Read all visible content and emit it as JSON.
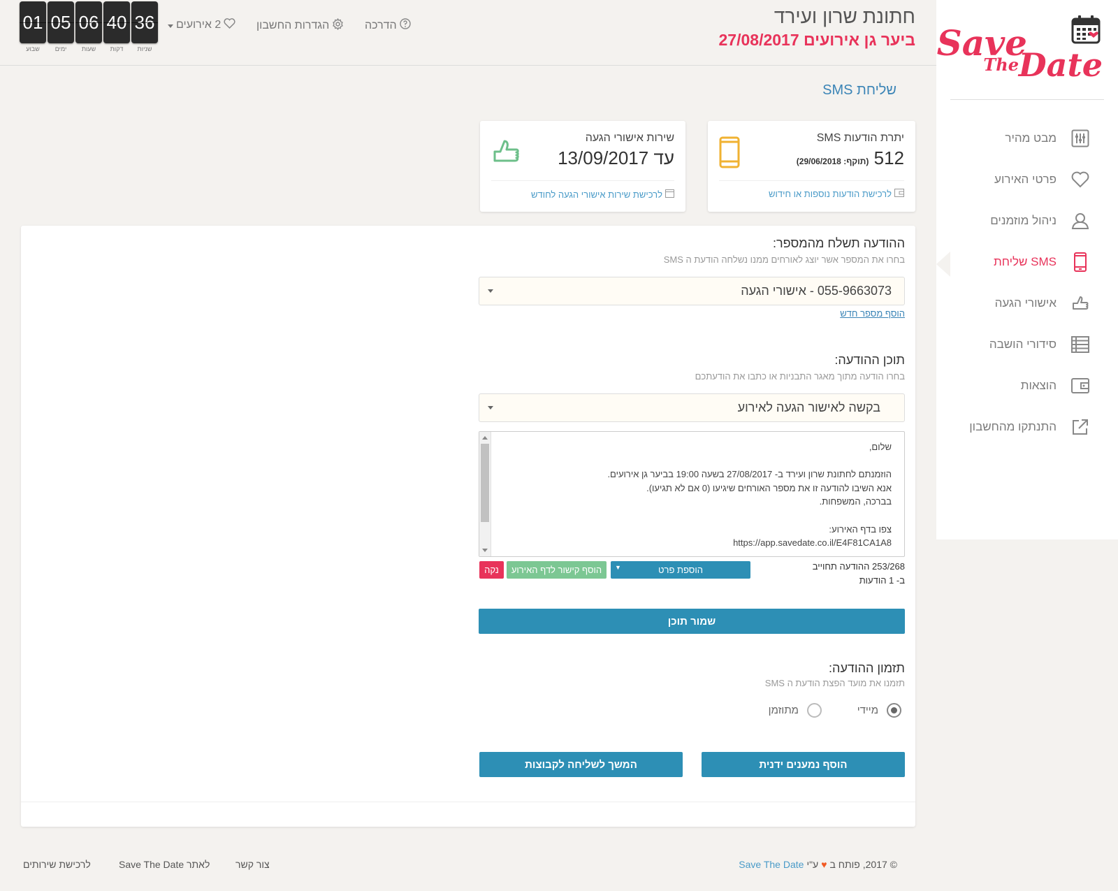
{
  "header": {
    "event_title": "חתונת שרון ועירד",
    "event_subtitle": "ביער גן אירועים 27/08/2017",
    "guide_label": "הדרכה",
    "account_settings_label": "הגדרות החשבון",
    "events_label": "2 אירועים"
  },
  "countdown": [
    {
      "value": "36",
      "label": "שניות"
    },
    {
      "value": "40",
      "label": "דקות"
    },
    {
      "value": "06",
      "label": "שעות"
    },
    {
      "value": "05",
      "label": "ימים"
    },
    {
      "value": "01",
      "label": "שבוע"
    }
  ],
  "logo": {
    "line1": "Save",
    "line2": "The",
    "line3": "Date"
  },
  "sidebar": {
    "items": [
      {
        "label": "מבט מהיר",
        "icon": "sliders-icon",
        "active": false
      },
      {
        "label": "פרטי האירוע",
        "icon": "heart-icon",
        "active": false
      },
      {
        "label": "ניהול מוזמנים",
        "icon": "user-icon",
        "active": false
      },
      {
        "label": "שליחת SMS",
        "icon": "mobile-icon",
        "active": true
      },
      {
        "label": "אישורי הגעה",
        "icon": "thumbs-up-icon",
        "active": false
      },
      {
        "label": "סידורי הושבה",
        "icon": "list-icon",
        "active": false
      },
      {
        "label": "הוצאות",
        "icon": "wallet-icon",
        "active": false
      },
      {
        "label": "התנתקו מהחשבון",
        "icon": "external-link-icon",
        "active": false
      }
    ]
  },
  "page_title": "שליחת SMS",
  "cards": {
    "sms": {
      "title": "יתרת הודעות SMS",
      "value": "512",
      "validity": "(תוקף: 29/06/2018)",
      "link": "לרכישת הודעות נוספות או חידוש"
    },
    "rsvp": {
      "title": "שירות אישורי הגעה",
      "value": "עד 13/09/2017",
      "link": "לרכישת שירות אישורי הגעה לחודש"
    }
  },
  "form": {
    "sender_title": "ההודעה תשלח מהמספר:",
    "sender_desc": "בחרו את המספר אשר יוצג לאורחים ממנו נשלחה הודעת ה SMS",
    "sender_selected": "055-9663073 - אישורי הגעה",
    "add_number_link": "הוסף מספר חדש",
    "content_title": "תוכן ההודעה:",
    "content_desc": "בחרו הודעה מתוך מאגר התבניות או כתבו את הודעתכם",
    "template_selected": "בקשה לאישור הגעה לאירוע",
    "message_text": "שלום,\n\nהוזמנתם לחתונת שרון ועירד ב- 27/08/2017 בשעה 19:00 בביער גן אירועים.\nאנא השיבו להודעה זו את מספר האורחים שיגיעו (0 אם לא תגיעו).\nבברכה, המשפחות.\n\nצפו בדף האירוע:\nhttps://app.savedate.co.il/E4F81CA1A8",
    "char_count": "253/268  ההודעה תחוייב",
    "message_count": "ב- 1 הודעות",
    "add_detail_button": "הוספת פרט",
    "add_link_button": "הוסף קישור לדף האירוע",
    "clear_button": "נקה",
    "save_button": "שמור תוכן",
    "timing_title": "תזמון ההודעה:",
    "timing_desc": "תזמנו את מועד הפצת הודעת ה SMS",
    "timing_immediate": "מיידי",
    "timing_scheduled": "מתוזמן",
    "add_recipients_button": "הוסף נמענים ידנית",
    "continue_groups_button": "המשך לשליחה לקבוצות"
  },
  "footer": {
    "copyright": "© 2017, פותח ב",
    "by": "ע\"י",
    "brand": "Save The Date",
    "contact": "צור קשר",
    "to_site": "לאתר Save The Date",
    "buy_services": "לרכישת שירותים"
  },
  "colors": {
    "accent_pink": "#e8335a",
    "primary_blue": "#2d8fb5",
    "link_blue": "#4a9bc8",
    "green": "#7cc793",
    "orange": "#f0b232"
  }
}
